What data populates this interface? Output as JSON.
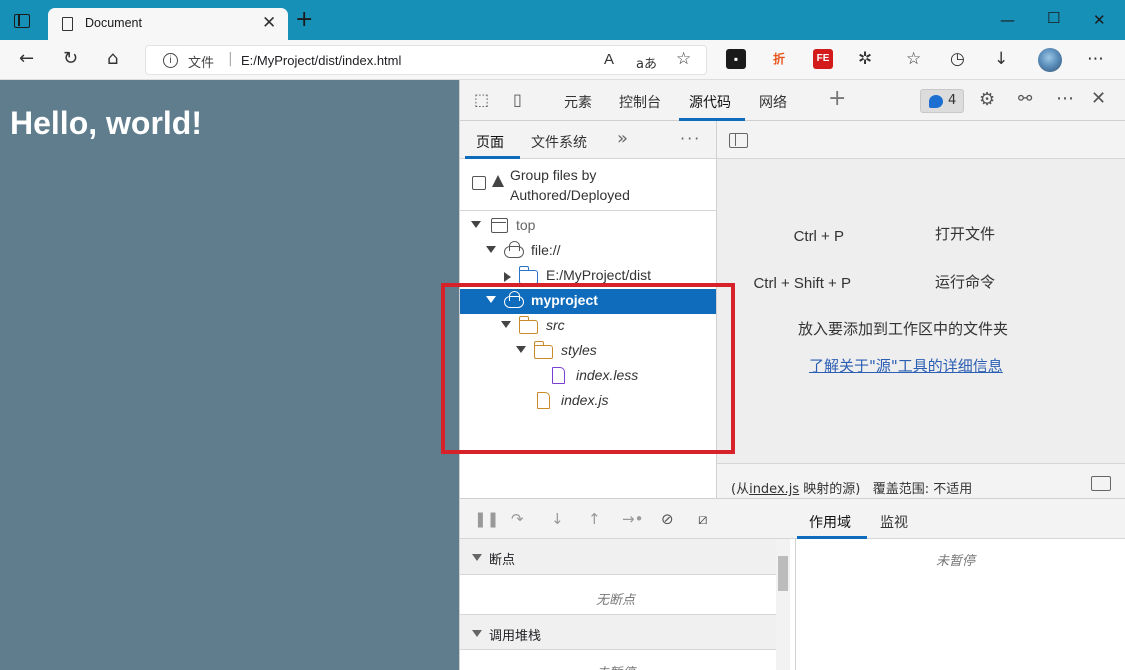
{
  "browser": {
    "tab_title": "Document",
    "url_scheme_label": "文件",
    "url": "E:/MyProject/dist/index.html",
    "ext_icons": [
      {
        "name": "extension-1-icon",
        "glyph": "■",
        "color": "#1a1a1a"
      },
      {
        "name": "extension-zhe-icon",
        "glyph": "折",
        "color": "#e8561e"
      },
      {
        "name": "extension-fe-icon",
        "glyph": "FE",
        "color": "#d31b1b"
      }
    ]
  },
  "page": {
    "heading": "Hello, world!"
  },
  "devtools": {
    "tabs": [
      "元素",
      "控制台",
      "源代码",
      "网络"
    ],
    "issues_count": "4",
    "navigator": {
      "tabs": [
        "页面",
        "文件系统"
      ],
      "more_tabs": "»",
      "menu": "⋮",
      "group_label_line1": "Group files by",
      "group_label_line2": "Authored/Deployed",
      "tree": [
        {
          "label": "top",
          "depth": 0,
          "icon": "frame",
          "expanded": true
        },
        {
          "label": "file://",
          "depth": 1,
          "icon": "cloud",
          "expanded": true
        },
        {
          "label": "E:/MyProject/dist",
          "depth": 2,
          "icon": "folder-blue",
          "expanded": false
        },
        {
          "label": "myproject",
          "depth": 1,
          "icon": "cloud",
          "expanded": true,
          "selected": true
        },
        {
          "label": "src",
          "depth": 2,
          "icon": "folder",
          "expanded": true,
          "italic": true
        },
        {
          "label": "styles",
          "depth": 3,
          "icon": "folder",
          "expanded": true,
          "italic": true
        },
        {
          "label": "index.less",
          "depth": 4,
          "icon": "doc-purple",
          "italic": true
        },
        {
          "label": "index.js",
          "depth": 3,
          "icon": "doc",
          "italic": true
        }
      ]
    },
    "editor": {
      "shortcut1_key": "Ctrl + P",
      "shortcut1_desc": "打开文件",
      "shortcut2_key": "Ctrl + Shift + P",
      "shortcut2_desc": "运行命令",
      "drop_text": "放入要添加到工作区中的文件夹",
      "learn_link": "了解关于\"源\"工具的详细信息",
      "status_prefix": "(从",
      "status_file": "index.js",
      "status_suffix": " 映射的源)",
      "coverage": "覆盖范围: 不适用"
    },
    "debugger": {
      "breakpoints_title": "断点",
      "no_breakpoints": "无断点",
      "callstack_title": "调用堆栈",
      "not_paused_partial": "未暂停"
    },
    "scope": {
      "tabs": [
        "作用域",
        "监视"
      ],
      "not_paused": "未暂停"
    }
  }
}
